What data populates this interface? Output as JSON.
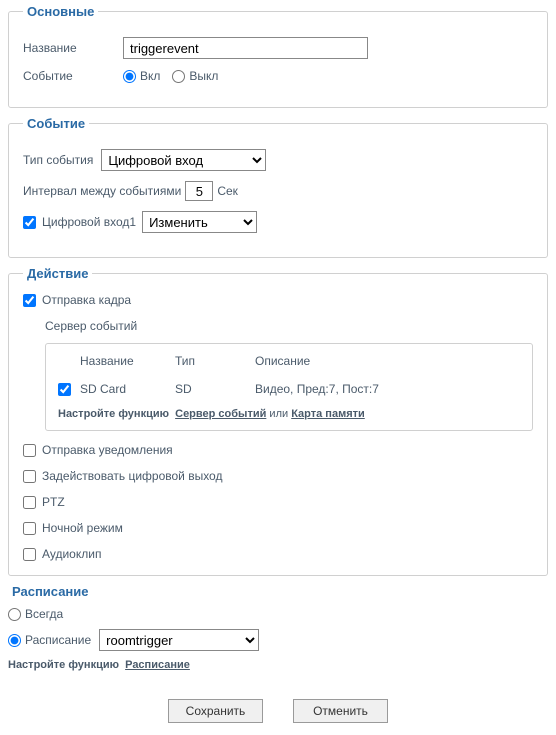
{
  "basic": {
    "legend": "Основные",
    "name_label": "Название",
    "name_value": "triggerevent",
    "event_label": "Событие",
    "on_label": "Вкл",
    "off_label": "Выкл"
  },
  "event": {
    "legend": "Событие",
    "type_label": "Тип события",
    "type_value": "Цифровой вход",
    "interval_label": "Интервал между событиями",
    "interval_value": "5",
    "interval_unit": "Сек",
    "digital_input_label": "Цифровой вход1",
    "change_value": "Изменить"
  },
  "action": {
    "legend": "Действие",
    "send_frame": "Отправка кадра",
    "event_server": "Сервер событий",
    "headers": {
      "name": "Название",
      "type": "Тип",
      "desc": "Описание"
    },
    "row": {
      "name": "SD Card",
      "type": "SD",
      "desc": "Видео, Пред:7, Пост:7"
    },
    "config_prefix": "Настройте функцию",
    "config_server_link": "Сервер событий",
    "config_or": "или",
    "config_card_link": "Карта памяти",
    "send_notification": "Отправка уведомления",
    "activate_digital_out": "Задействовать цифровой выход",
    "ptz": "PTZ",
    "night_mode": "Ночной режим",
    "audioclip": "Аудиоклип"
  },
  "schedule": {
    "legend": "Расписание",
    "always": "Всегда",
    "schedule_label": "Расписание",
    "schedule_value": "roomtrigger",
    "config_prefix": "Настройте функцию",
    "config_link": "Расписание"
  },
  "buttons": {
    "save": "Сохранить",
    "cancel": "Отменить"
  }
}
